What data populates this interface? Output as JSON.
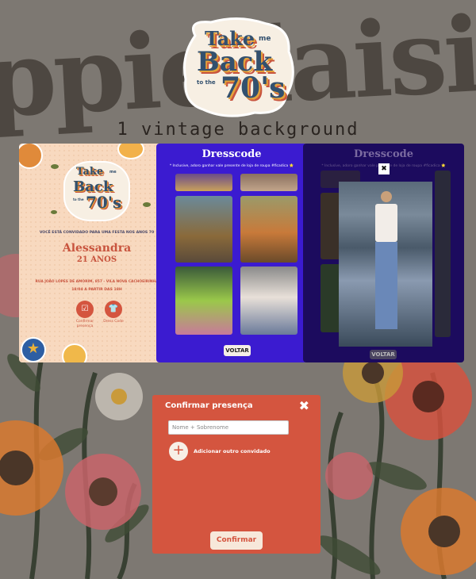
{
  "background": {
    "watermark_text": "ppiedaisi",
    "colors": {
      "base": "#7f7a73",
      "flower_orange": "#e07a2e",
      "flower_pink": "#c8646a",
      "stem": "#2f3a2a"
    }
  },
  "logo": {
    "line1": "Take",
    "line2": "me",
    "line3": "Back",
    "line4": "to the",
    "line5": "70's"
  },
  "caption": "1 vintage background",
  "invite": {
    "logo": {
      "line1": "Take",
      "line2": "me",
      "line3": "Back",
      "line4": "to the",
      "line5": "70's"
    },
    "intro": "VOCÊ ESTÁ CONVIDADO PARA UMA FESTA NOS ANOS 70",
    "name": "Alessandra",
    "age": "21 ANOS",
    "address": "RUA JOÃO LOPES DE AMORIM, 857 - VILA NOVA CACHOEIRINHA",
    "date": "18/04 A PARTIR DAS 18H",
    "confirm_label": "Confirmar presença",
    "dresscode_label": "Dress Code"
  },
  "dresscode": {
    "title": "Dresscode",
    "subtitle": "* Inclusive, adoro ganhar vale presente de loja de roupa #ficadica ⭐",
    "back_label": "VOLTAR"
  },
  "dresscode_popup": {
    "title": "Dresscode",
    "subtitle": "* Inclusive, adoro ganhar vale presente de loja de roupa #ficadica ⭐",
    "close_label": "✖",
    "back_label": "VOLTAR"
  },
  "modal": {
    "title": "Confirmar presença",
    "close_label": "✖",
    "name_placeholder": "Nome + Sobrenome",
    "add_icon": "+",
    "add_label": "Adicionar outro convidado",
    "submit_label": "Confirmar"
  }
}
